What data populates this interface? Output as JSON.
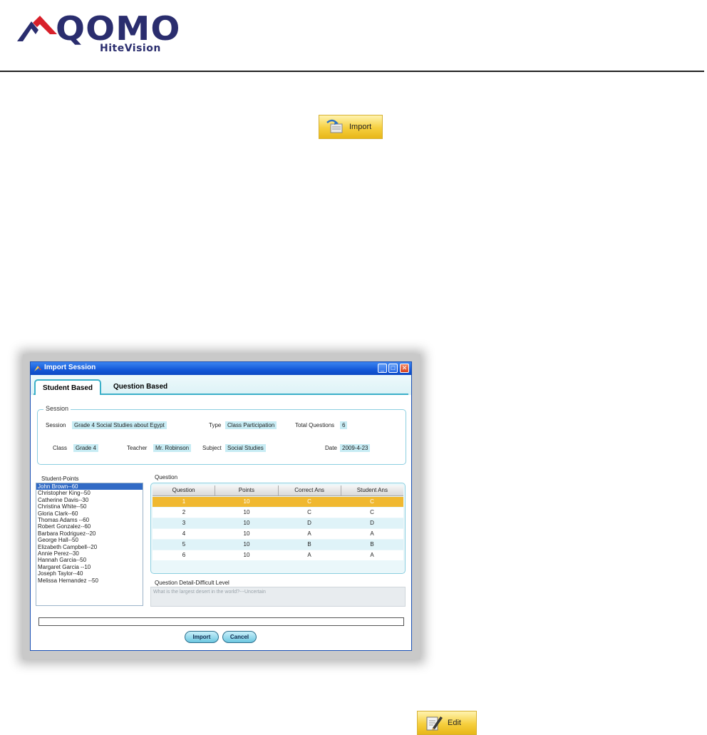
{
  "logo": {
    "wordmark": "QOMO",
    "sub": "HiteVision"
  },
  "top_button": {
    "label": "Import",
    "icon": "import-icon"
  },
  "dialog": {
    "title": "Import Session",
    "tabs": [
      {
        "label": "Student Based"
      },
      {
        "label": "Question Based"
      }
    ],
    "session_group": {
      "legend": "Session",
      "session_label": "Session",
      "session_value": "Grade 4 Social Studies about Egypt",
      "type_label": "Type",
      "type_value": "Class Participation",
      "total_label": "Total Questions",
      "total_value": "6",
      "class_label": "Class",
      "class_value": "Grade 4",
      "teacher_label": "Teacher",
      "teacher_value": "Mr. Robinson",
      "subject_label": "Subject",
      "subject_value": "Social Studies",
      "date_label": "Date",
      "date_value": "2009-4-23"
    },
    "student_points_label": "Student-Points",
    "students": [
      "John Brown--60",
      "Christopher  King--50",
      "Catherine Davis--30",
      "Christina White--50",
      "Gloria Clark--60",
      "Thomas Adams --60",
      "Robert Gonzalez--60",
      "Barbara Rodriguez--20",
      "George Hall--50",
      "Elizabeth Campbell--20",
      "Annie Perez--30",
      "Hannah Garcia--50",
      "Margaret Garcia --10",
      "Joseph Taylor--40",
      "Melissa Hernandez --50"
    ],
    "question_label": "Question",
    "question_columns": [
      "Question",
      "Points",
      "Correct Ans",
      "Student Ans"
    ],
    "questions": [
      [
        "1",
        "10",
        "C",
        "C"
      ],
      [
        "2",
        "10",
        "C",
        "C"
      ],
      [
        "3",
        "10",
        "D",
        "D"
      ],
      [
        "4",
        "10",
        "A",
        "A"
      ],
      [
        "5",
        "10",
        "B",
        "B"
      ],
      [
        "6",
        "10",
        "A",
        "A"
      ]
    ],
    "detail_label": "Question Detail-Difficult Level",
    "detail_text": "What is the largest desert in the world?---Uncertain",
    "import_label": "Import",
    "cancel_label": "Cancel"
  },
  "bottom_button": {
    "label": "Edit",
    "icon": "edit-icon"
  },
  "colors": {
    "titlebar": "#1458d8",
    "tab_accent": "#3bb0c9",
    "selected_row": "#f0b830",
    "gold": "#f6cf3e"
  }
}
